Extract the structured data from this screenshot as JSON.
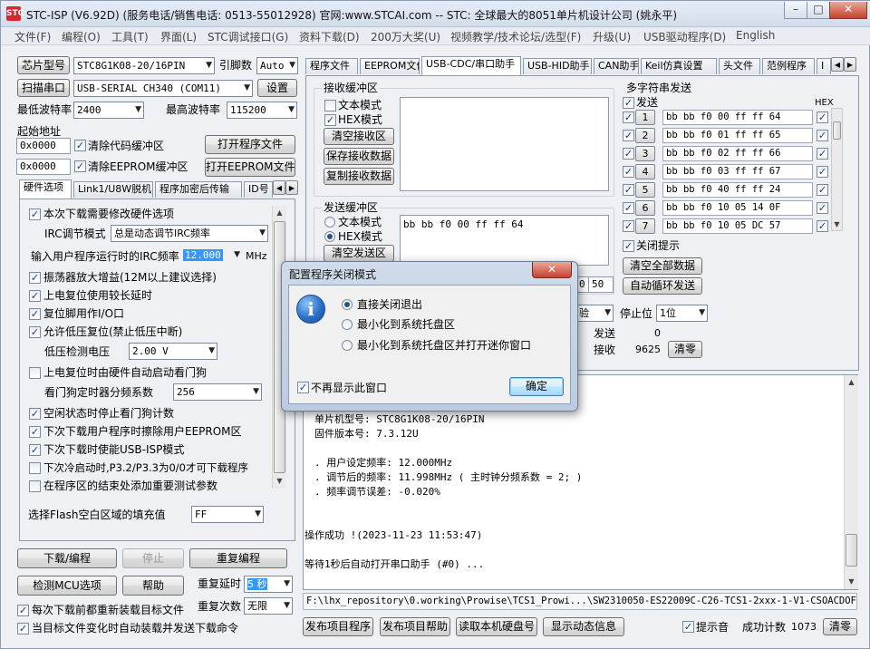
{
  "window": {
    "title": "STC-ISP (V6.92D) (服务电话/销售电话: 0513-55012928) 官网:www.STCAI.com  -- STC: 全球最大的8051单片机设计公司 (姚永平)",
    "minimize": "–",
    "maximize": "□",
    "close": "✕"
  },
  "menu": [
    "文件(F)",
    "编程(O)",
    "工具(T)",
    "界面(L)",
    "STC调试接口(G)",
    "资料下载(D)",
    "200万大奖(U)",
    "视频教学/技术论坛/选型(F)",
    "升级(U)",
    "USB驱动程序(D)",
    "English"
  ],
  "left": {
    "chip_model_button": "芯片型号",
    "chip_model_value": "STC8G1K08-20/16PIN",
    "pin_label": "引脚数",
    "pin_value": "Auto",
    "scan_port_button": "扫描串口",
    "port_value": "USB-SERIAL CH340 (COM11)",
    "settings_button": "设置",
    "min_baud_label": "最低波特率",
    "min_baud_value": "2400",
    "max_baud_label": "最高波特率",
    "max_baud_value": "115200",
    "start_addr_label": "起始地址",
    "addr1_value": "0x0000",
    "clear_code_label": "清除代码缓冲区",
    "open_prog_button": "打开程序文件",
    "addr2_value": "0x0000",
    "clear_eeprom_label": "清除EEPROM缓冲区",
    "open_eeprom_button": "打开EEPROM文件",
    "tabs": [
      "硬件选项",
      "Link1/U8W脱机",
      "程序加密后传输",
      "ID号"
    ],
    "options": {
      "modify_hw": "本次下载需要修改硬件选项",
      "irc_mode_label": "IRC调节模式",
      "irc_mode_value": "总是动态调节IRC频率",
      "irc_freq_label": "输入用户程序运行时的IRC频率",
      "irc_freq_value": "12.000",
      "irc_unit": "MHz",
      "osc_gain": "振荡器放大增益(12M以上建议选择)",
      "long_reset": "上电复位使用较长延时",
      "reset_pin_io": "复位脚用作I/O口",
      "lvd_reset": "允许低压复位(禁止低压中断)",
      "lvd_label": "低压检测电压",
      "lvd_value": "2.00 V",
      "wdt_auto": "上电复位时由硬件自动启动看门狗",
      "wdt_div_label": "看门狗定时器分频系数",
      "wdt_div_value": "256",
      "idle_wdt_stop": "空闲状态时停止看门狗计数",
      "erase_eeprom": "下次下载用户程序时擦除用户EEPROM区",
      "usb_isp": "下次下载时使能USB-ISP模式",
      "p32p33": "下次冷启动时,P3.2/P3.3为0/0才可下载程序",
      "add_params": "在程序区的结束处添加重要测试参数",
      "flash_fill_label": "选择Flash空白区域的填充值",
      "flash_fill_value": "FF"
    },
    "download_button": "下载/编程",
    "stop_button": "停止",
    "reprogram_button": "重复编程",
    "detect_button": "检测MCU选项",
    "help_button": "帮助",
    "repeat_delay_label": "重复延时",
    "repeat_delay_value": "5 秒",
    "repeat_count_label": "重复次数",
    "repeat_count_value": "无限",
    "reload_each": "每次下载前都重新装载目标文件",
    "auto_send": "当目标文件变化时自动装载并发送下载命令"
  },
  "right": {
    "tabs": [
      "程序文件",
      "EEPROM文件",
      "USB-CDC/串口助手",
      "USB-HID助手",
      "CAN助手",
      "Keil仿真设置",
      "头文件",
      "范例程序",
      "I"
    ],
    "recv": {
      "title": "接收缓冲区",
      "text_mode": "文本模式",
      "hex_mode": "HEX模式",
      "clear_button": "清空接收区",
      "save_button": "保存接收数据",
      "copy_button": "复制接收数据"
    },
    "send": {
      "title": "发送缓冲区",
      "text_mode": "文本模式",
      "hex_mode": "HEX模式",
      "clear_button": "清空发送区",
      "content": "bb bb f0 00 ff ff 64",
      "interval_value": "50"
    },
    "multi": {
      "title": "多字符串发送",
      "send_label": "发送",
      "hex_label": "HEX",
      "rows": [
        {
          "n": "1",
          "v": "bb bb f0 00 ff ff 64"
        },
        {
          "n": "2",
          "v": "bb bb f0 01 ff ff 65"
        },
        {
          "n": "3",
          "v": "bb bb f0 02 ff ff 66"
        },
        {
          "n": "4",
          "v": "bb bb f0 03 ff ff 67"
        },
        {
          "n": "5",
          "v": "bb bb f0 40 ff ff 24"
        },
        {
          "n": "6",
          "v": "bb bb f0 10 05 14 0F"
        },
        {
          "n": "7",
          "v": "bb bb f0 10 05 DC 57"
        }
      ],
      "close_hint": "关闭提示",
      "clear_all_button": "清空全部数据",
      "auto_loop_button": "自动循环发送"
    },
    "serial": {
      "parity_value": "验",
      "stop_label": "停止位",
      "stop_value": "1位",
      "send_label": "发送",
      "send_count": "0",
      "recv_label": "接收",
      "recv_count": "9625",
      "clear_button": "清零"
    },
    "log": {
      "l1": "单片机型号: STC8G1K08-20/16PIN",
      "l2": "固件版本号: 7.3.12U",
      "l3": ". 用户设定频率: 12.000MHz",
      "l4": ". 调节后的频率: 11.998MHz ( 主时钟分频系数 = 2; )",
      "l5": ". 频率调节误差: -0.020%",
      "l6": "操作成功 !(2023-11-23 11:53:47)",
      "l7": "等待1秒后自动打开串口助手 (#0) ..."
    },
    "path": "F:\\lhx_repository\\0.working\\Prowise\\TCS1_Prowi...\\SW2310050-ES22009C-C26-TCS1-2xxx-1-V1-CSOACDOFH.hex",
    "bottom": {
      "publish_prog": "发布项目程序",
      "publish_help": "发布项目帮助",
      "read_disk": "读取本机硬盘号",
      "show_dynamic": "显示动态信息",
      "beep": "提示音",
      "success_label": "成功计数",
      "success_count": "1073",
      "clear_button": "清零"
    }
  },
  "dialog": {
    "title": "配置程序关闭模式",
    "close": "✕",
    "opt1": "直接关闭退出",
    "opt2": "最小化到系统托盘区",
    "opt3": "最小化到系统托盘区并打开迷你窗口",
    "no_show": "不再显示此窗口",
    "ok_button": "确定"
  }
}
